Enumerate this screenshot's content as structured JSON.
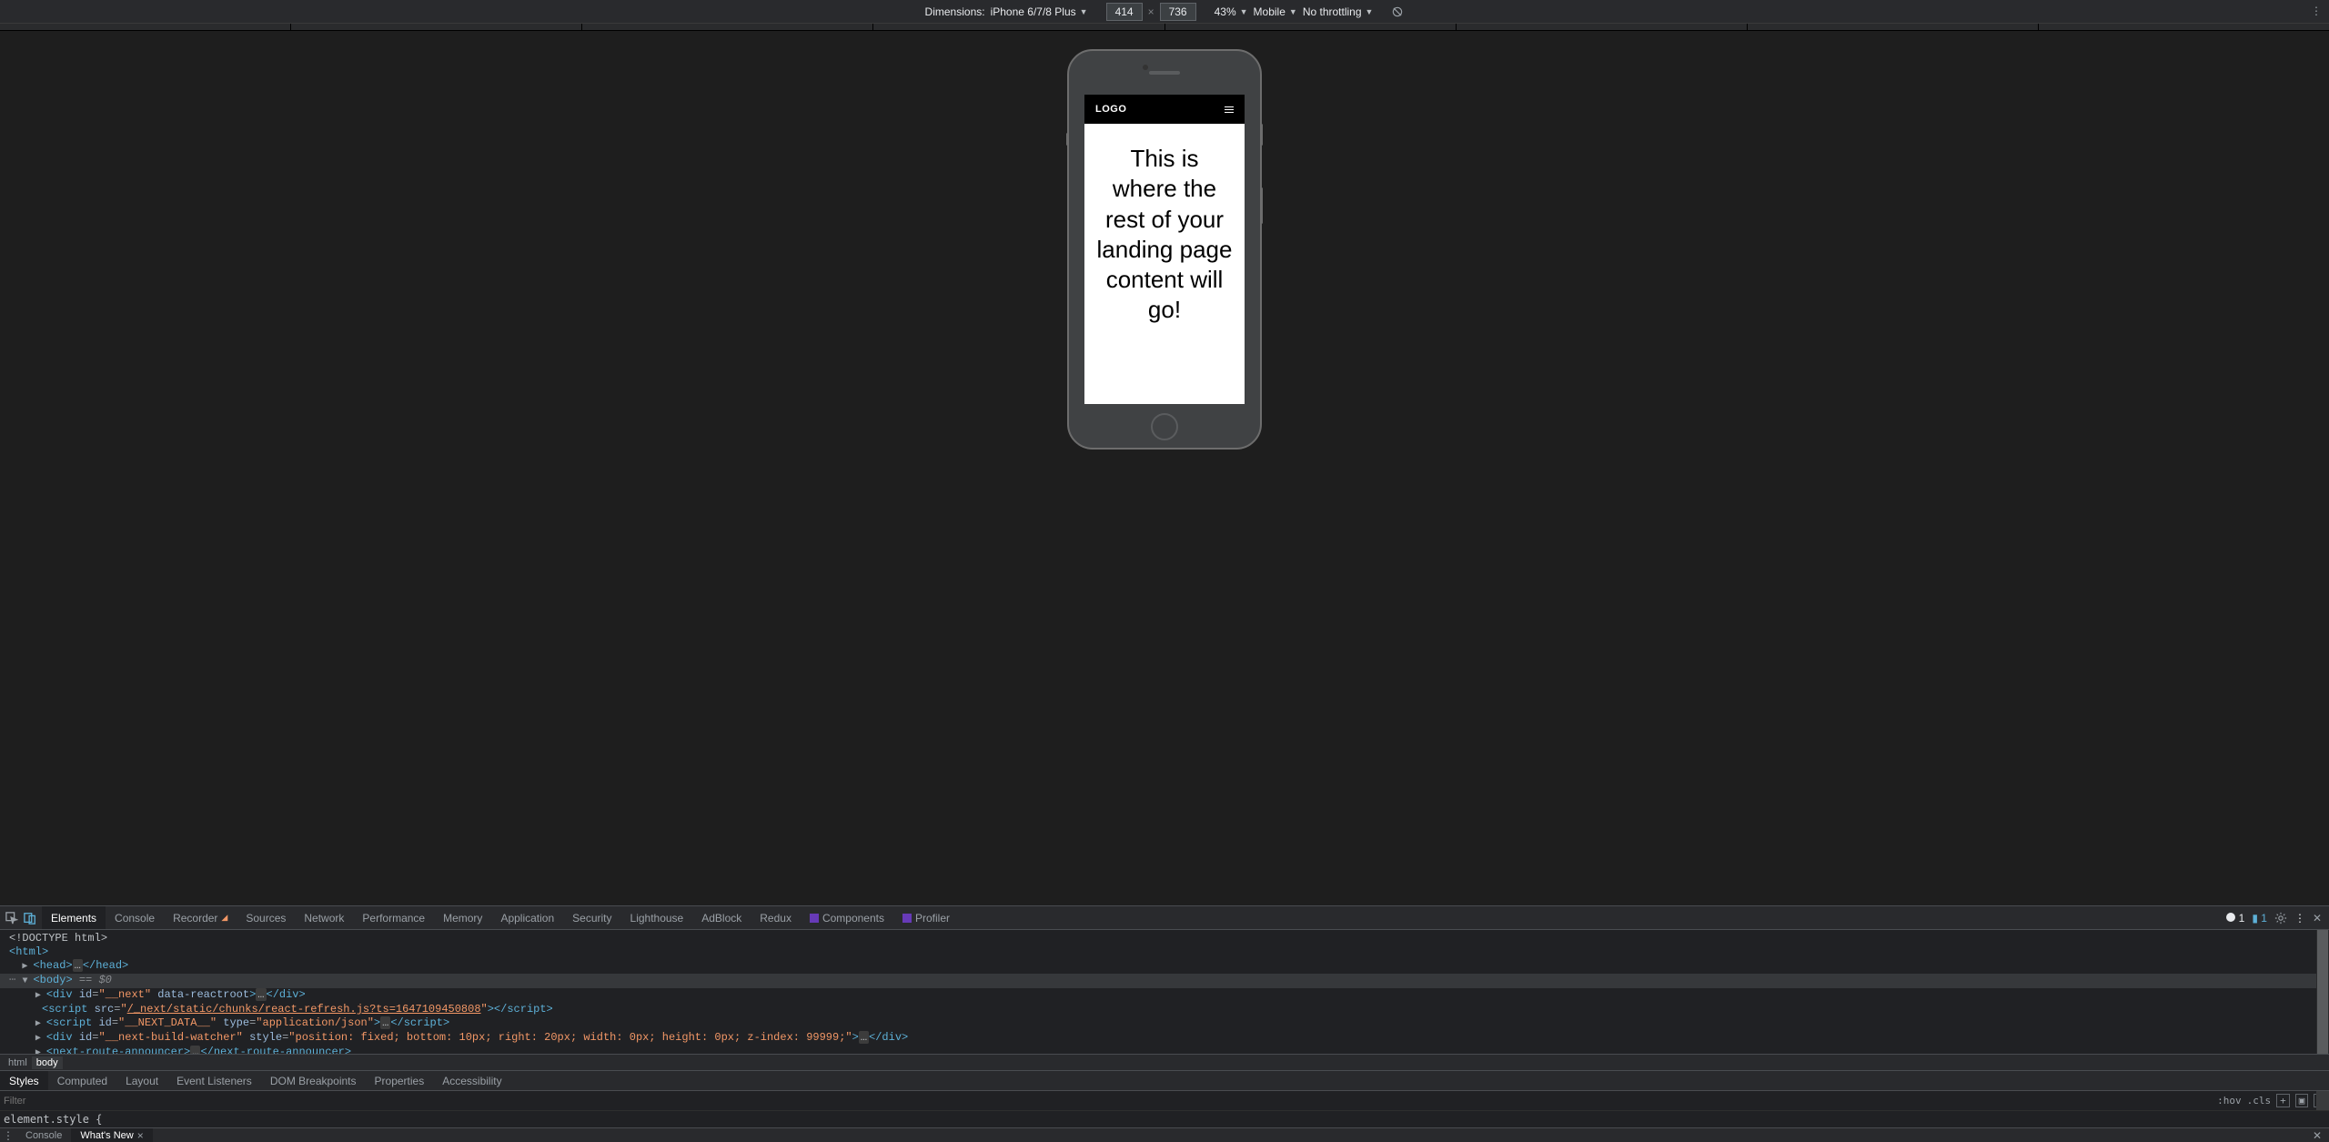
{
  "toolbar": {
    "dimensions_label": "Dimensions:",
    "device_name": "iPhone 6/7/8 Plus",
    "width": "414",
    "height": "736",
    "zoom": "43%",
    "device_type": "Mobile",
    "throttling": "No throttling"
  },
  "phone": {
    "logo": "LOGO",
    "content": "This is where the rest of your landing page content will go!"
  },
  "devtools": {
    "tabs": [
      "Elements",
      "Console",
      "Recorder",
      "Sources",
      "Network",
      "Performance",
      "Memory",
      "Application",
      "Security",
      "Lighthouse",
      "AdBlock",
      "Redux",
      "Components",
      "Profiler"
    ],
    "active_tab": "Elements",
    "error_count": "1",
    "msg_count": "1",
    "breadcrumb": [
      "html",
      "body"
    ],
    "styles_tabs": [
      "Styles",
      "Computed",
      "Layout",
      "Event Listeners",
      "DOM Breakpoints",
      "Properties",
      "Accessibility"
    ],
    "styles_filter_placeholder": "Filter",
    "hov": ":hov",
    "cls": ".cls",
    "element_style": "element.style {",
    "tree": {
      "doctype": "<!DOCTYPE html>",
      "html_open": "<html>",
      "head": {
        "open": "<head>",
        "close": "</head>"
      },
      "body": {
        "open": "<body>",
        "sel": " == $0"
      },
      "div_next": {
        "id": "__next",
        "attr": "data-reactroot"
      },
      "script1": {
        "src": "/_next/static/chunks/react-refresh.js?ts=1647109450808"
      },
      "script2": {
        "id": "__NEXT_DATA__",
        "type": "application/json"
      },
      "div_watcher": {
        "id": "__next-build-watcher",
        "style": "position: fixed; bottom: 10px; right: 20px; width: 0px; height: 0px; z-index: 99999;"
      },
      "announcer": "next-route-announcer"
    }
  },
  "drawer": {
    "tabs": [
      "Console",
      "What's New"
    ],
    "active": "What's New"
  }
}
